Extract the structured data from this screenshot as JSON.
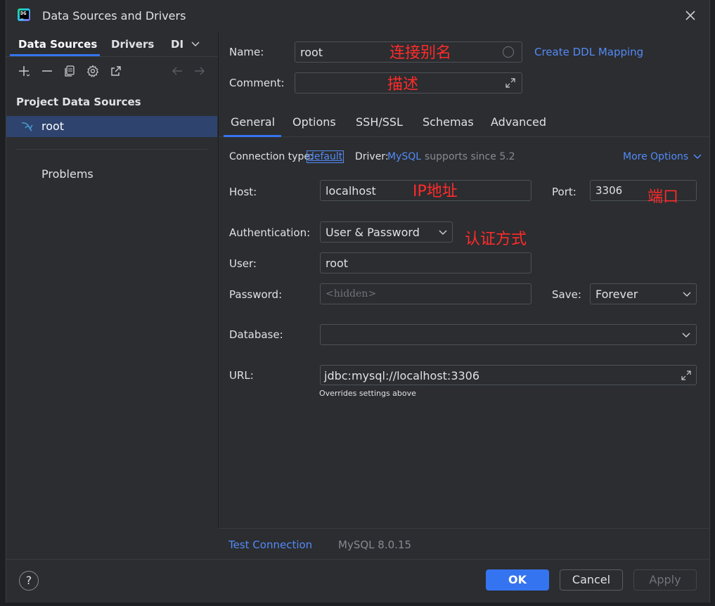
{
  "window": {
    "title": "Data Sources and Drivers"
  },
  "left": {
    "tabs": [
      "Data Sources",
      "Drivers",
      "DI"
    ],
    "section_title": "Project Data Sources",
    "items": [
      {
        "label": "root",
        "icon": "mysql-dolphin-icon"
      }
    ],
    "problems": "Problems"
  },
  "form": {
    "name_label": "Name:",
    "name_value": "root",
    "name_annotation": "连接别名",
    "create_ddl_mapping": "Create DDL Mapping",
    "comment_label": "Comment:",
    "comment_annotation": "描述",
    "tabs": [
      "General",
      "Options",
      "SSH/SSL",
      "Schemas",
      "Advanced"
    ],
    "connection_type_label": "Connection type:",
    "connection_type_value": "default",
    "driver_label": "Driver:",
    "driver_value": "MySQL",
    "driver_note": "supports since 5.2",
    "more_options": "More Options",
    "host_label": "Host:",
    "host_value": "localhost",
    "host_annotation": "IP地址",
    "port_label": "Port:",
    "port_value": "3306",
    "port_annotation": "端口",
    "auth_label": "Authentication:",
    "auth_value": "User & Password",
    "auth_annotation": "认证方式",
    "user_label": "User:",
    "user_value": "root",
    "password_label": "Password:",
    "password_placeholder": "<hidden>",
    "save_label": "Save:",
    "save_value": "Forever",
    "database_label": "Database:",
    "database_value": "",
    "url_label": "URL:",
    "url_value": "jdbc:mysql://localhost:3306",
    "url_note": "Overrides settings above"
  },
  "bottom": {
    "test_connection": "Test Connection",
    "server_version": "MySQL 8.0.15"
  },
  "footer": {
    "help": "?",
    "ok": "OK",
    "cancel": "Cancel",
    "apply": "Apply"
  },
  "colors": {
    "accent": "#3574f0",
    "link": "#548af7",
    "annotation": "#ff2b2b",
    "selection": "#2e436e"
  }
}
